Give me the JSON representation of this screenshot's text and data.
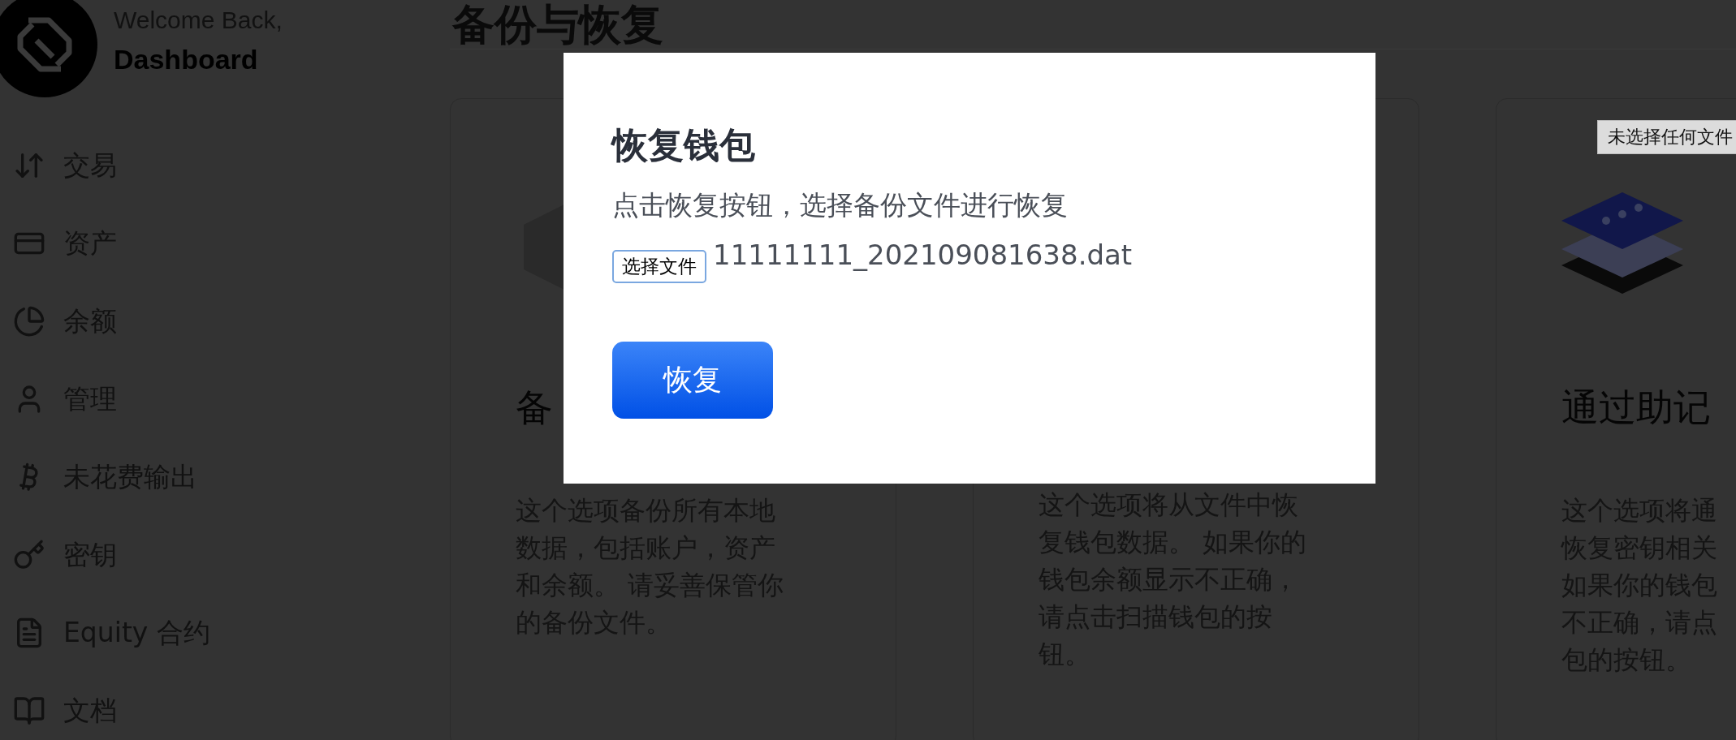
{
  "sidebar": {
    "greeting": "Welcome Back,",
    "title": "Dashboard",
    "items": [
      {
        "label": "交易",
        "kind": "transfer"
      },
      {
        "label": "资产",
        "kind": "card"
      },
      {
        "label": "余额",
        "kind": "pie"
      },
      {
        "label": "管理",
        "kind": "user"
      },
      {
        "label": "未花费输出",
        "kind": "bitcoin"
      },
      {
        "label": "密钥",
        "kind": "key"
      },
      {
        "label": "Equity 合约",
        "kind": "document"
      },
      {
        "label": "文档",
        "kind": "book"
      }
    ]
  },
  "page": {
    "title": "备份与恢复",
    "cards": [
      {
        "kind": "server",
        "heading": "备",
        "text": "这个选项备份所有本地数据，包括账户，资产和余额。 请妥善保管你的备份文件。"
      },
      {
        "kind": "none",
        "text": "这个选项将从文件中恢复钱包数据。 如果你的钱包余额显示不正确，请点击扫描钱包的按钮。"
      },
      {
        "kind": "layers",
        "heading": "通过助记",
        "text": "这个选项将通恢复密钥相关如果你的钱包不正确，请点包的按钮。"
      }
    ]
  },
  "tooltip": "未选择任何文件",
  "dialog": {
    "title": "恢复钱包",
    "description": "点击恢复按钮，选择备份文件进行恢复",
    "file_button": "选择文件",
    "file_name": "11111111_202109081638.dat",
    "restore_button": "恢复"
  }
}
